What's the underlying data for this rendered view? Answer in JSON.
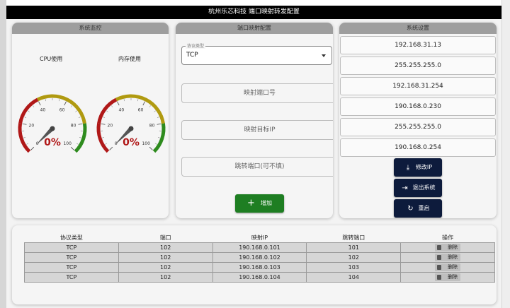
{
  "app": {
    "title": "杭州乐芯科技 端口映射转发配置"
  },
  "monitor": {
    "header": "系统监控",
    "gauges": [
      {
        "label": "CPU使用",
        "value": 0,
        "value_text": "0%",
        "ticks": [
          "0",
          "20",
          "40",
          "60",
          "80",
          "100"
        ]
      },
      {
        "label": "内存使用",
        "value": 0,
        "value_text": "0%",
        "ticks": [
          "0",
          "20",
          "40",
          "60",
          "80",
          "100"
        ]
      }
    ],
    "colors": {
      "low": "#2e8b1e",
      "mid": "#b09a10",
      "high": "#b01818",
      "value_text": "#b01818"
    }
  },
  "port_mapping": {
    "header": "端口映射配置",
    "protocol_label": "协议类型",
    "protocol_value": "TCP",
    "map_port_placeholder": "映射端口号",
    "map_target_ip_placeholder": "映射目标IP",
    "jump_port_placeholder": "跳转端口(可不填)",
    "add_label": "增加",
    "add_color": "#1e7e22"
  },
  "system_settings": {
    "header": "系统设置",
    "fields": [
      "192.168.31.13",
      "255.255.255.0",
      "192.168.31.254",
      "190.168.0.230",
      "255.255.255.0",
      "190.168.0.254"
    ],
    "buttons": {
      "modify_ip": "修改IP",
      "exit_system": "退出系统",
      "restart": "重启"
    },
    "button_color": "#0d1b3c"
  },
  "rules_table": {
    "columns": [
      "协议类型",
      "端口",
      "映射IP",
      "跳转端口",
      "操作"
    ],
    "delete_label": "删除",
    "rows": [
      {
        "protocol": "TCP",
        "port": "102",
        "ip": "190.168.0.101",
        "jump": "101"
      },
      {
        "protocol": "TCP",
        "port": "102",
        "ip": "190.168.0.102",
        "jump": "102"
      },
      {
        "protocol": "TCP",
        "port": "102",
        "ip": "190.168.0.103",
        "jump": "103"
      },
      {
        "protocol": "TCP",
        "port": "102",
        "ip": "190.168.0.104",
        "jump": "104"
      }
    ]
  }
}
